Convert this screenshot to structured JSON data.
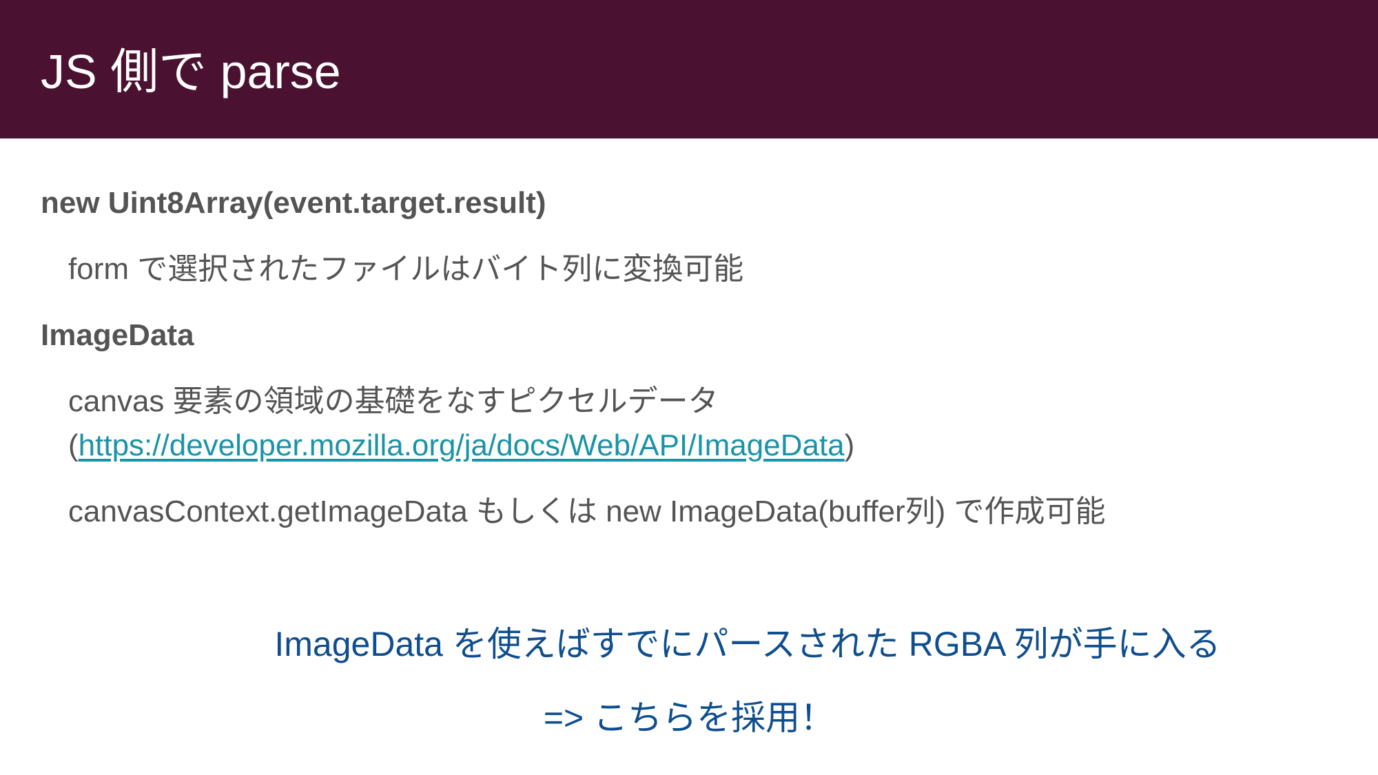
{
  "slide": {
    "title": "JS 側で parse",
    "items": [
      {
        "heading": "new Uint8Array(event.target.result)"
      },
      {
        "text": "form で選択されたファイルはバイト列に変換可能"
      },
      {
        "heading": "ImageData"
      },
      {
        "text": "canvas 要素の領域の基礎をなすピクセルデータ"
      },
      {
        "link_open": "(",
        "link": "https://developer.mozilla.org/ja/docs/Web/API/ImageData",
        "link_close": ")"
      },
      {
        "text": "canvasContext.getImageData もしくは new ImageData(buffer列) で作成可能"
      }
    ],
    "callout": {
      "line1": "ImageData を使えばすでにパースされた RGBA 列が手に入る",
      "line2": "=> こちらを採用！"
    },
    "colors": {
      "header_bg": "#4a1230",
      "body_text": "#545454",
      "link": "#1a93a8",
      "callout": "#0f4e8e"
    }
  }
}
